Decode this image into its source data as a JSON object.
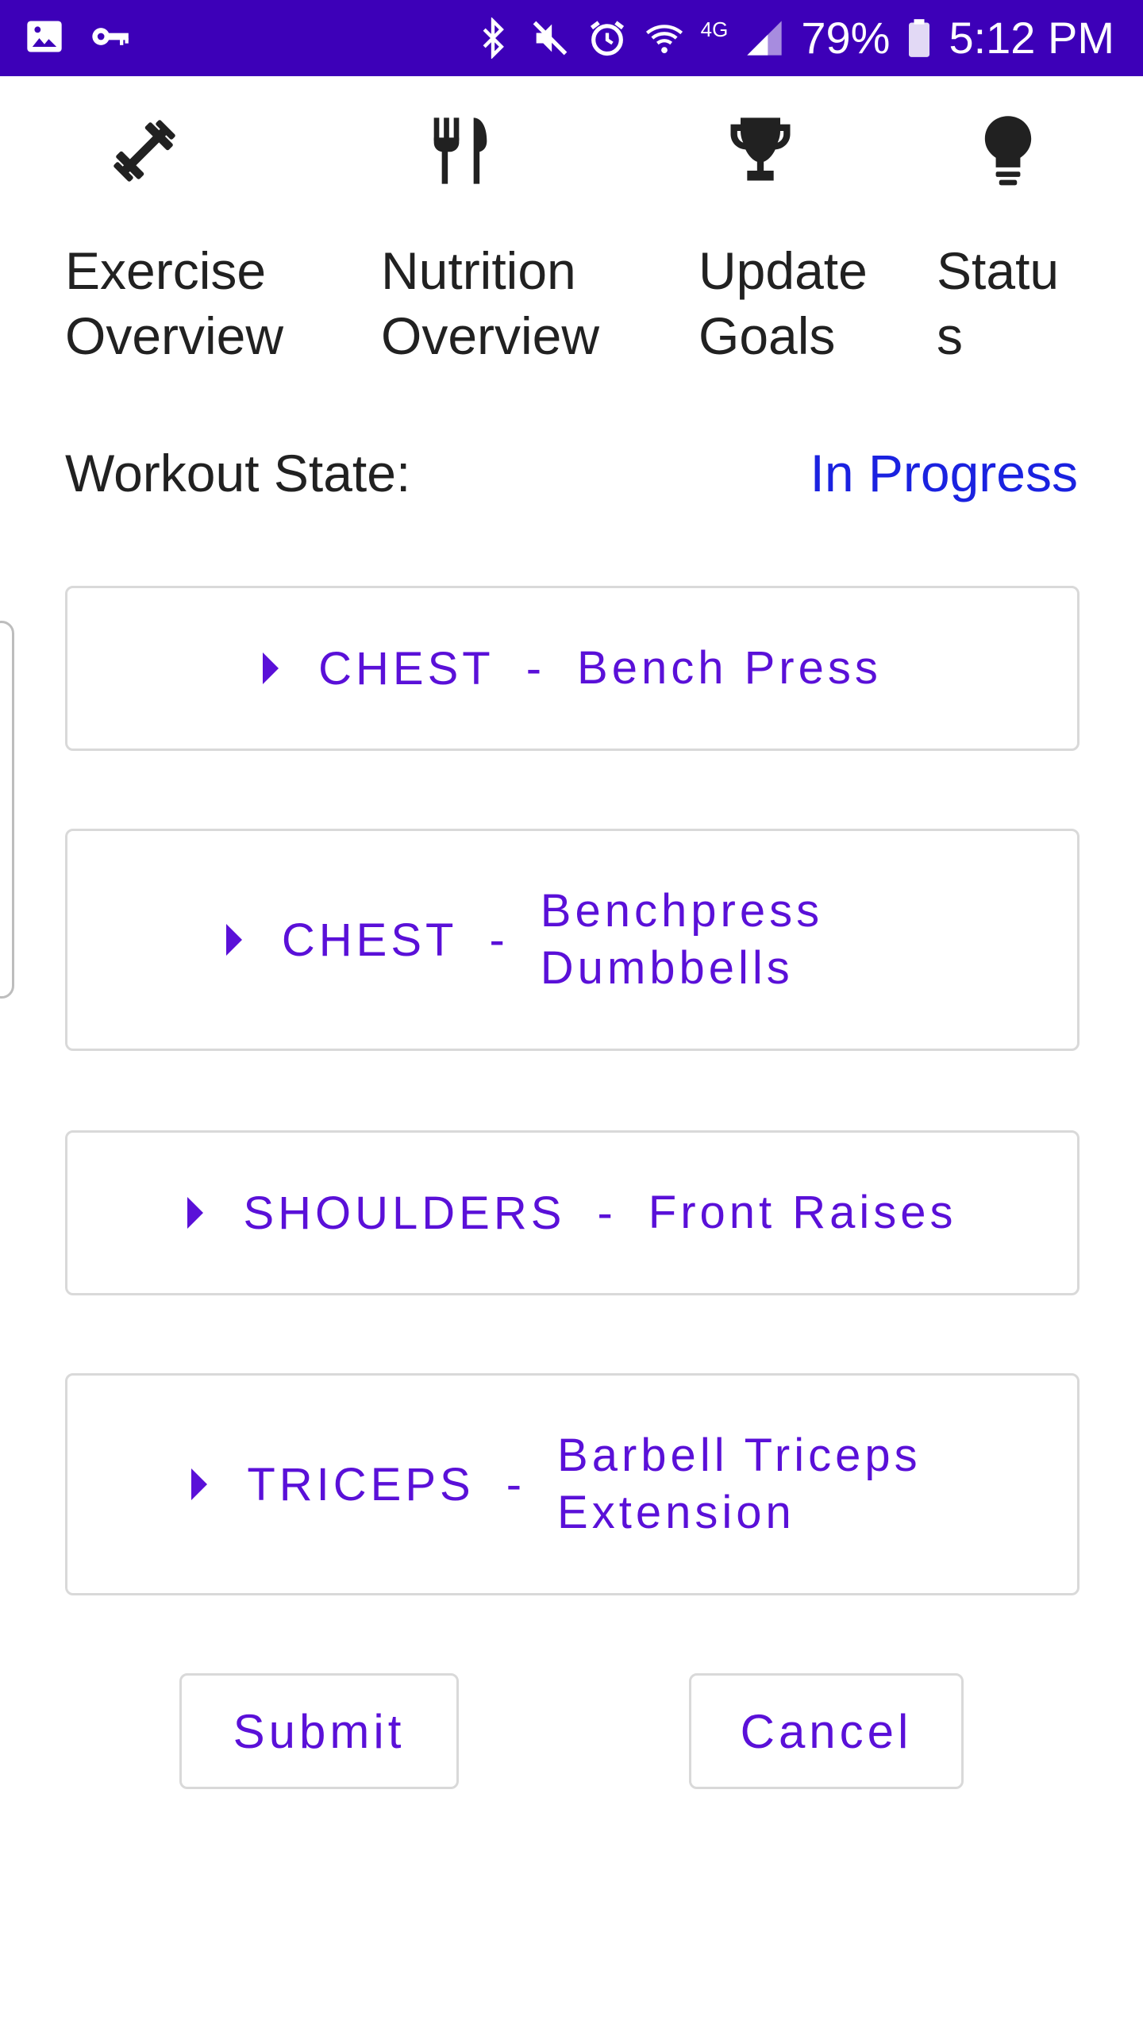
{
  "status_bar": {
    "battery": "79%",
    "time": "5:12 PM",
    "network": "4G",
    "icons": [
      "image-icon",
      "key-icon",
      "bluetooth-icon",
      "mute-icon",
      "alarm-icon",
      "wifi-icon",
      "signal-icon",
      "battery-icon"
    ]
  },
  "nav": [
    {
      "label": "Exercise\nOverview",
      "icon": "dumbbell-icon"
    },
    {
      "label": "Nutrition\nOverview",
      "icon": "utensils-icon"
    },
    {
      "label": "Update\nGoals",
      "icon": "trophy-icon"
    },
    {
      "label": "Statu\ns",
      "icon": "lightbulb-icon"
    }
  ],
  "workout_state": {
    "label": "Workout State:",
    "value": "In Progress"
  },
  "exercises": [
    {
      "muscle": "CHEST",
      "separator": "-",
      "exercise": "Bench Press"
    },
    {
      "muscle": "CHEST",
      "separator": "-",
      "exercise": "Benchpress\nDumbbells"
    },
    {
      "muscle": "SHOULDERS",
      "separator": "-",
      "exercise": "Front Raises"
    },
    {
      "muscle": "TRICEPS",
      "separator": "-",
      "exercise": "Barbell Triceps\nExtension"
    }
  ],
  "buttons": {
    "submit": "Submit",
    "cancel": "Cancel"
  },
  "colors": {
    "status_bar": "#3d00b8",
    "accent": "#5a10d8",
    "state_value": "#1a22e0"
  }
}
